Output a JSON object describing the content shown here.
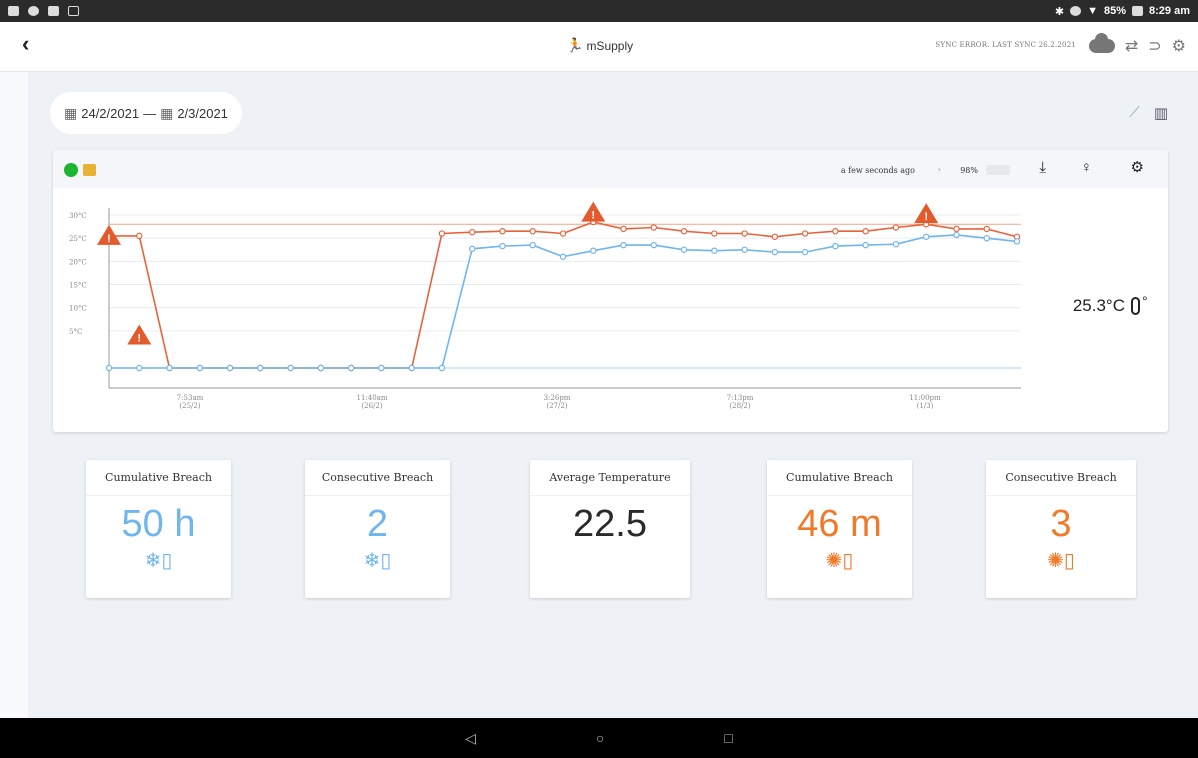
{
  "status_bar": {
    "battery": "85%",
    "time": "8:29 am"
  },
  "header": {
    "brand": "mSupply",
    "sync_status": "SYNC ERROR. LAST SYNC 26.2.2021",
    "icons": [
      "cloud-icon",
      "sync-arrows-icon",
      "rss-icon",
      "settings-icon"
    ]
  },
  "date_range": {
    "from": "24/2/2021",
    "separator": "—",
    "to": "2/3/2021"
  },
  "sensor": {
    "last_seen": "a few seconds ago",
    "battery": "98%",
    "current_temp": "25.3°C"
  },
  "chart_data": {
    "type": "line",
    "x_tick_labels": [
      "7:53am (25/2)",
      "11:40am (26/2)",
      "3:26pm (27/2)",
      "7:13pm (28/2)",
      "11:00pm (1/3)"
    ],
    "y_tick_labels": [
      "30°C",
      "25°C",
      "20°C",
      "15°C",
      "10°C",
      "5°C"
    ],
    "ylim": [
      -5,
      32
    ],
    "threshold_lines": [
      28,
      -3
    ],
    "series": [
      {
        "color": "#e8623a",
        "values": [
          25.5,
          25.5,
          -3,
          -3,
          -3,
          -3,
          -3,
          -3,
          -3,
          -3,
          -3,
          26,
          26.3,
          26.5,
          26.5,
          26,
          28.5,
          27,
          27.3,
          26.5,
          26,
          26,
          25.3,
          26,
          26.5,
          26.5,
          27.3,
          28,
          27,
          27,
          25.3
        ]
      },
      {
        "color": "#6fb5ef",
        "values": [
          -3,
          -3,
          -3,
          -3,
          -3,
          -3,
          -3,
          -3,
          -3,
          -3,
          -3,
          -3,
          22.7,
          23.3,
          23.5,
          21,
          22.3,
          23.5,
          23.5,
          22.5,
          22.3,
          22.5,
          22,
          22,
          23.3,
          23.5,
          23.7,
          25.3,
          25.7,
          25,
          24.3
        ]
      }
    ],
    "breach_markers": [
      {
        "index": 0,
        "value": 25.5
      },
      {
        "index": 1,
        "value": 4
      },
      {
        "index": 16,
        "value": 30.5
      },
      {
        "index": 27,
        "value": 30.2
      }
    ]
  },
  "stats": [
    {
      "label": "Cumulative Breach",
      "value": "50 h",
      "kind": "cold"
    },
    {
      "label": "Consecutive Breach",
      "value": "2",
      "kind": "cold"
    },
    {
      "label": "Average Temperature",
      "value": "22.5",
      "kind": "neutral"
    },
    {
      "label": "Cumulative Breach",
      "value": "46 m",
      "kind": "hot"
    },
    {
      "label": "Consecutive Breach",
      "value": "3",
      "kind": "hot"
    }
  ],
  "colors": {
    "cold": "#6fb5ef",
    "hot": "#f07a2a",
    "online": "#1db430"
  }
}
